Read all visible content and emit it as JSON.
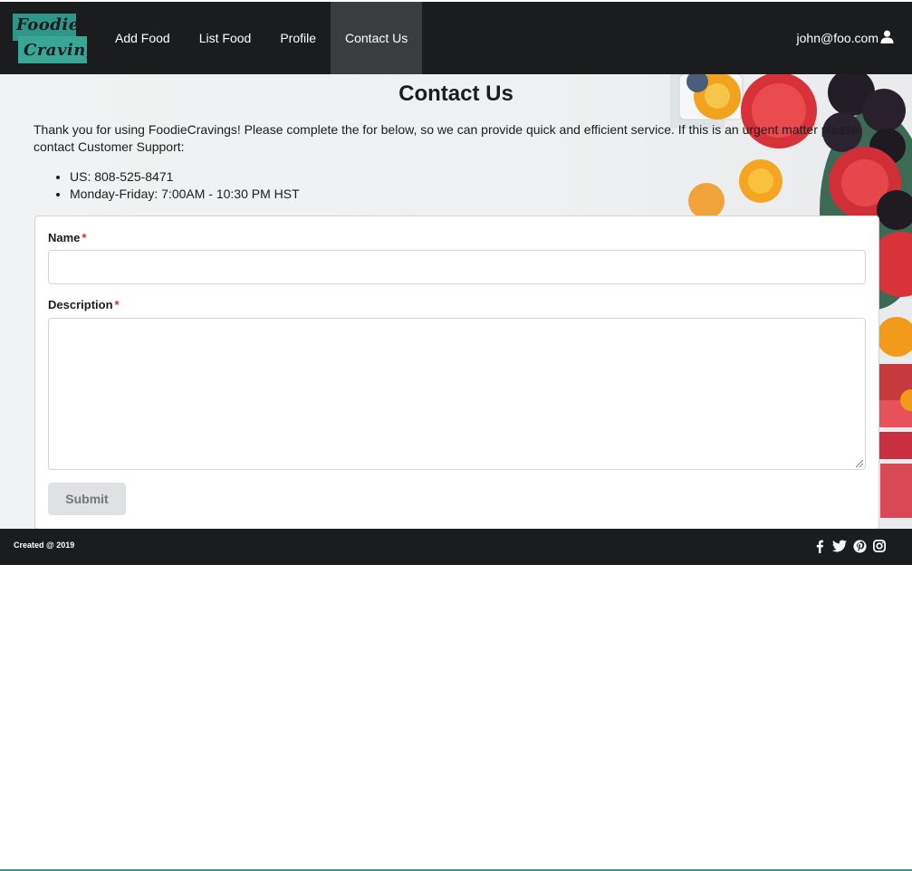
{
  "brand": {
    "line1": "Foodie",
    "line2": "Cravings"
  },
  "nav": {
    "items": [
      {
        "label": "Add Food",
        "active": false
      },
      {
        "label": "List Food",
        "active": false
      },
      {
        "label": "Profile",
        "active": false
      },
      {
        "label": "Contact Us",
        "active": true
      }
    ],
    "user": "john@foo.com",
    "user_icon": "user-icon"
  },
  "main": {
    "title": "Contact Us",
    "intro": "Thank you for using FoodieCravings! Please complete the for below, so we can provide quick and efficient service. If this is an urgent matter please contact Customer Support:",
    "contacts": [
      "US: 808-525-8471",
      "Monday-Friday: 7:00AM - 10:30 PM HST"
    ]
  },
  "form": {
    "name_label": "Name",
    "name_value": "",
    "description_label": "Description",
    "description_value": "",
    "required_mark": "*",
    "submit_label": "Submit"
  },
  "footer": {
    "created": "Created @ 2019",
    "social": [
      "facebook-icon",
      "twitter-icon",
      "pinterest-icon",
      "instagram-icon"
    ]
  },
  "colors": {
    "nav_bg": "#1b1c1d",
    "nav_active": "#3b3c3d",
    "brand_teal": "#2f9e8f",
    "required": "#db2828",
    "button_bg": "#e0e1e2"
  }
}
